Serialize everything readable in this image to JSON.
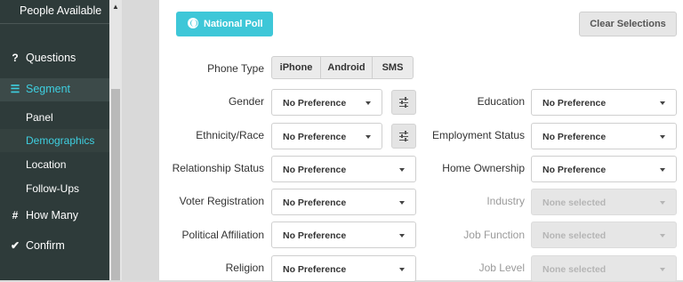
{
  "sidebar": {
    "top_label": "People Available",
    "items": [
      {
        "label": "Questions",
        "icon": "question-icon"
      },
      {
        "label": "Segment",
        "icon": "list-icon"
      },
      {
        "label": "How Many",
        "icon": "hash-icon"
      },
      {
        "label": "Confirm",
        "icon": "check-icon"
      }
    ],
    "sub_items": [
      "Panel",
      "Demographics",
      "Location",
      "Follow-Ups"
    ]
  },
  "header": {
    "poll_button": "National Poll",
    "clear_button": "Clear Selections"
  },
  "form": {
    "phone_type": {
      "label": "Phone Type",
      "options": [
        "iPhone",
        "Android",
        "SMS"
      ]
    },
    "left": [
      {
        "label": "Gender",
        "value": "No Preference"
      },
      {
        "label": "Ethnicity/Race",
        "value": "No Preference"
      },
      {
        "label": "Relationship Status",
        "value": "No Preference"
      },
      {
        "label": "Voter Registration",
        "value": "No Preference"
      },
      {
        "label": "Political Affiliation",
        "value": "No Preference"
      },
      {
        "label": "Religion",
        "value": "No Preference"
      }
    ],
    "right": [
      {
        "label": "Education",
        "value": "No Preference"
      },
      {
        "label": "Employment Status",
        "value": "No Preference"
      },
      {
        "label": "Home Ownership",
        "value": "No Preference"
      },
      {
        "label": "Industry",
        "value": "None selected"
      },
      {
        "label": "Job Function",
        "value": "None selected"
      },
      {
        "label": "Job Level",
        "value": "None selected"
      }
    ]
  },
  "colors": {
    "accent": "#3ec7d8",
    "sidebar": "#2e3b3a"
  }
}
